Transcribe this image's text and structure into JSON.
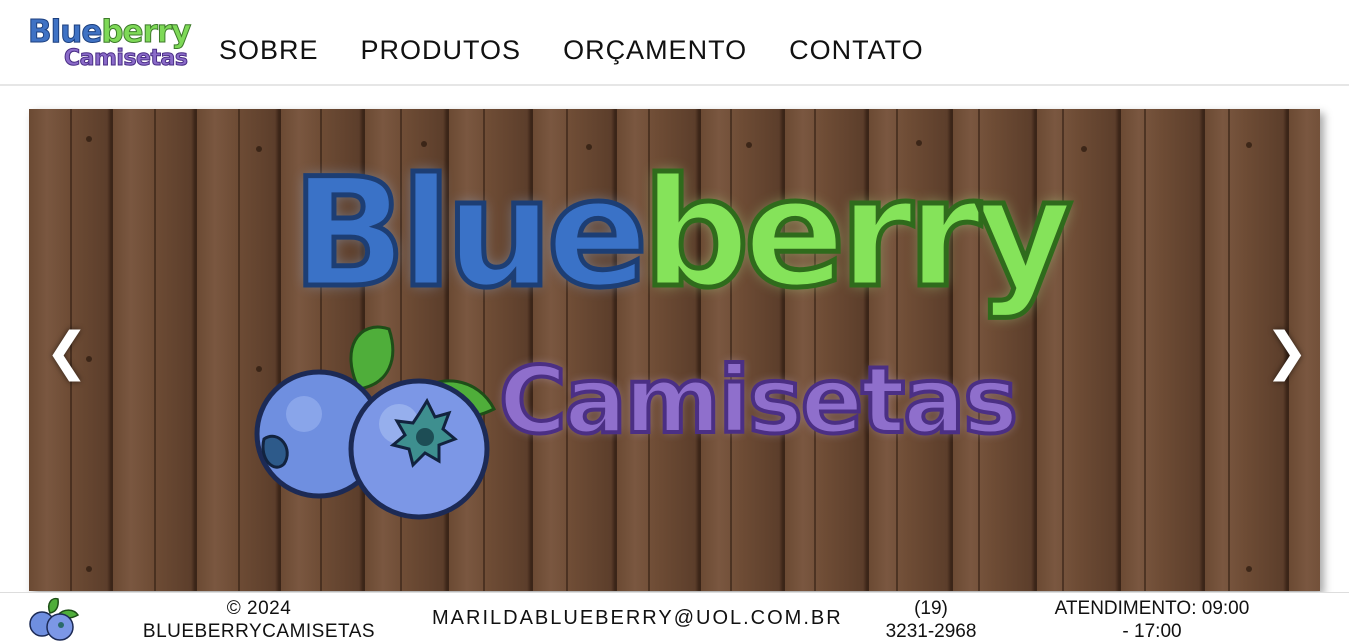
{
  "brand": {
    "logo_word_blue": "Blue",
    "logo_word_green": "berry",
    "logo_sub": "Camisetas",
    "colors": {
      "blue": "#3a72c7",
      "green": "#85e35a",
      "purple": "#8f6fcc",
      "wood": "#6b4a33"
    }
  },
  "nav": {
    "items": [
      {
        "label": "SOBRE"
      },
      {
        "label": "PRODUTOS"
      },
      {
        "label": "ORÇAMENTO"
      },
      {
        "label": "CONTATO"
      }
    ]
  },
  "hero": {
    "title_blue": "Blue",
    "title_green": "berry",
    "subtitle": "Camisetas",
    "prev_icon": "❮",
    "next_icon": "❯"
  },
  "footer": {
    "copyright_line1": "© 2024",
    "copyright_line2": "BLUEBERRYCAMISETAS",
    "email": "MARILDABLUEBERRY@UOL.COM.BR",
    "phone_line1": "(19)",
    "phone_line2": "3231-2968",
    "hours_line1": "ATENDIMENTO: 09:00",
    "hours_line2": "- 17:00"
  }
}
